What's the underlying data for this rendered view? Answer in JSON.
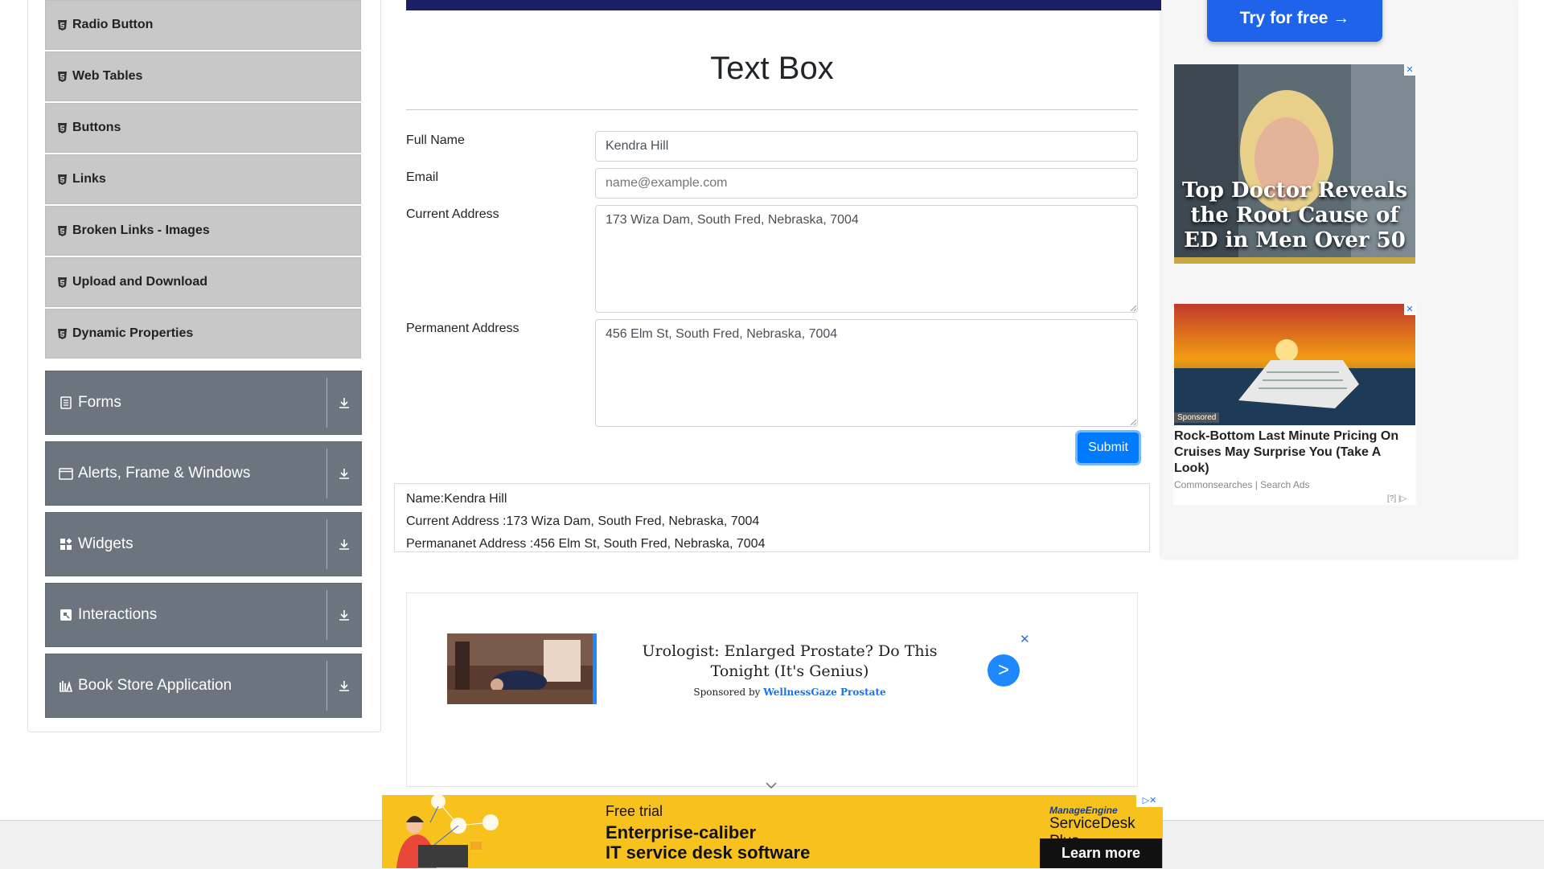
{
  "sidebar": {
    "sub_items": [
      {
        "label": "Radio Button"
      },
      {
        "label": "Web Tables"
      },
      {
        "label": "Buttons"
      },
      {
        "label": "Links"
      },
      {
        "label": "Broken Links - Images"
      },
      {
        "label": "Upload and Download"
      },
      {
        "label": "Dynamic Properties"
      }
    ],
    "groups": [
      {
        "label": "Forms",
        "icon": "document-icon"
      },
      {
        "label": "Alerts, Frame & Windows",
        "icon": "window-icon"
      },
      {
        "label": "Widgets",
        "icon": "widgets-icon"
      },
      {
        "label": "Interactions",
        "icon": "interactions-icon"
      },
      {
        "label": "Book Store Application",
        "icon": "library-icon"
      }
    ]
  },
  "main": {
    "title": "Text Box",
    "form": {
      "full_name_label": "Full Name",
      "full_name_value": "Kendra Hill",
      "email_label": "Email",
      "email_placeholder": "name@example.com",
      "current_address_label": "Current Address",
      "current_address_value": "173 Wiza Dam, South Fred, Nebraska, 7004",
      "permanent_address_label": "Permanent Address",
      "permanent_address_value": "456 Elm St, South Fred, Nebraska, 7004",
      "submit_label": "Submit"
    },
    "output": {
      "name": "Name:Kendra Hill",
      "current_address": "Current Address :173 Wiza Dam, South Fred, Nebraska, 7004",
      "permanent_address": "Permananet Address :456 Elm St, South Fred, Nebraska, 7004"
    }
  },
  "native_ad": {
    "headline": "Urologist: Enlarged Prostate? Do This Tonight (It's Genius)",
    "sponsored_prefix": "Sponsored by",
    "sponsor": "WellnessGaze Prostate",
    "close": "✕",
    "arrow": ">"
  },
  "banner_ad": {
    "small": "Free trial",
    "line1": "Enterprise-caliber",
    "line2": "IT service desk software",
    "brand_top": "ManageEngine",
    "brand_name": "ServiceDesk Plus",
    "cta": "Learn more",
    "close": "▷✕"
  },
  "right_ads": {
    "try_label": "Try for free →",
    "ad1_text": "Top Doctor Reveals the Root Cause of ED in Men Over 50",
    "ad2_sponsored": "Sponsored",
    "ad2_title": "Rock-Bottom Last Minute Pricing On Cruises May Surprise You (Take A Look)",
    "ad2_source": "Commonsearches | Search Ads",
    "ad2_info": "[?] |▷",
    "close": "✕"
  },
  "colors": {
    "group_bg": "#6c757d",
    "sub_item_bg": "#c8c8c8",
    "submit_bg": "#007bff",
    "topbar": "#1b2066",
    "banner_bg": "#f8c21e"
  }
}
